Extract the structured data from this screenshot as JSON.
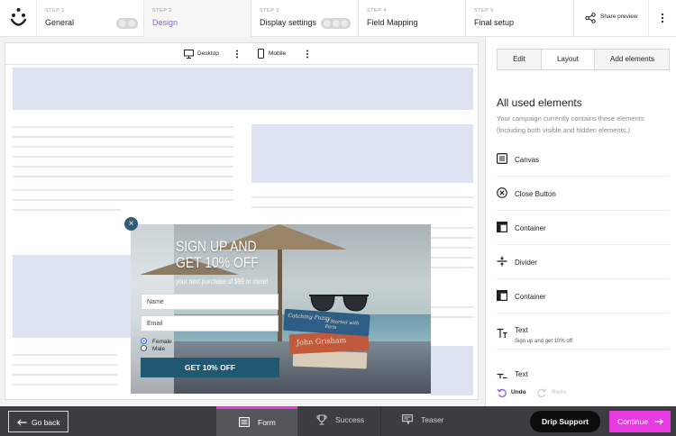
{
  "steps": [
    {
      "num": "STEP 1",
      "label": "General"
    },
    {
      "num": "STEP 2",
      "label": "Design"
    },
    {
      "num": "STEP 3",
      "label": "Display settings"
    },
    {
      "num": "STEP 4",
      "label": "Field Mapping"
    },
    {
      "num": "STEP 5",
      "label": "Final setup"
    }
  ],
  "share_preview": "Share preview",
  "devices": {
    "desktop": "Desktop",
    "mobile": "Mobile"
  },
  "popup": {
    "title_line1": "SIGN UP AND",
    "title_line2": "GET 10% OFF",
    "subtitle": "your next purchase of $99 or more!",
    "name_placeholder": "Name",
    "email_placeholder": "Email",
    "gender_options": [
      "Female",
      "Male"
    ],
    "cta": "GET 10% OFF",
    "book_titles": [
      "Catching Fuzzy",
      "It Started with Paris",
      "John Grisham"
    ]
  },
  "panel": {
    "tabs": [
      "Edit",
      "Layout",
      "Add elements"
    ],
    "title": "All used elements",
    "description": "Your campaign currently contains these elements (including both visible and hidden elements.)",
    "elements": [
      {
        "label": "Canvas",
        "sub": ""
      },
      {
        "label": "Close Button",
        "sub": ""
      },
      {
        "label": "Container",
        "sub": ""
      },
      {
        "label": "Divider",
        "sub": ""
      },
      {
        "label": "Container",
        "sub": ""
      },
      {
        "label": "Text",
        "sub": "Sign up and get 10% off"
      },
      {
        "label": "Text",
        "sub": ""
      }
    ],
    "undo": "Undo",
    "redo": "Redo"
  },
  "bottom": {
    "go_back": "Go back",
    "tabs": [
      "Form",
      "Success",
      "Teaser"
    ],
    "drip_support": "Drip Support",
    "continue": "Continue"
  },
  "colors": {
    "accent": "#8f63d8",
    "continue": "#e83ae0",
    "cta": "#1f5870",
    "active_tab_bar": "#e839d8"
  }
}
